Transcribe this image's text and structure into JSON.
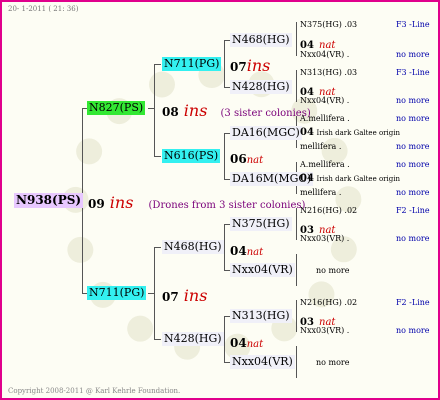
{
  "header": {
    "date": "20- 1-2011 ( 21: 36)"
  },
  "footer": {
    "copyright": "Copyright 2008-2011 @ Karl Kehrle Foundation."
  },
  "root": {
    "label": "N938(PS)",
    "year": "09",
    "mark": "ins",
    "note": "(Drones from 3 sister colonies)"
  },
  "sire": {
    "label": "N827(PS)",
    "year": "08",
    "mark": "ins",
    "note": "(3 sister colonies)"
  },
  "dam": {
    "label": "N711(PG)",
    "year": "07",
    "mark": "ins"
  },
  "s_s": {
    "label": "N711(PG)",
    "year": "07",
    "mark": "ins"
  },
  "s_d": {
    "label": "N616(PS)",
    "year": "06",
    "mark": "nat"
  },
  "d_s": {
    "label": "N468(HG)",
    "year": "04",
    "mark": "nat"
  },
  "d_d": {
    "label": "N428(HG)",
    "year": "04",
    "mark": "nat"
  },
  "g1": {
    "label": "N468(HG)",
    "year": "04",
    "mark": "nat"
  },
  "g2": {
    "label": "N428(HG)",
    "year": "04",
    "mark": "nat"
  },
  "g3": {
    "label": "DA16(MGC)",
    "year": "04",
    "mark": "Irish dark Galtee origin"
  },
  "g4": {
    "label": "DA16M(MGC)",
    "year": "04",
    "mark": "Irish dark Galtee origin"
  },
  "g5": {
    "label": "N375(HG)",
    "year": "03",
    "mark": "nat"
  },
  "g6": {
    "label": "Nxx04(VR)"
  },
  "g7": {
    "label": "N313(HG)",
    "year": "03",
    "mark": "nat"
  },
  "g8": {
    "label": "Nxx04(VR)"
  },
  "ggp": [
    {
      "a": "N375(HG) .03",
      "line": "F3 -Line",
      "c": "Nxx04(VR) .",
      "more": "no more"
    },
    {
      "a": "N313(HG) .03",
      "line": "F3 -Line",
      "c": "Nxx04(VR) .",
      "more": "no more"
    },
    {
      "a": "A.mellifera .",
      "more1": "no more",
      "c": "mellifera .",
      "more": "no more"
    },
    {
      "a": "A.mellifera .",
      "more1": "no more",
      "c": "mellifera .",
      "more": "no more"
    },
    {
      "a": "N216(HG) .02",
      "line": "F2 -Line",
      "c": "Nxx03(VR) .",
      "more": "no more"
    },
    {
      "a": "N216(HG) .02",
      "line": "F2 -Line",
      "c": "Nxx03(VR) .",
      "more": "no more"
    }
  ],
  "nomore_mid": [
    "no more",
    "no more"
  ],
  "colors": {
    "frame": "#e0008c",
    "root": "#e8c8ff",
    "green": "#33e833",
    "cyan": "#33f0f0",
    "accent": "#cc0000"
  }
}
